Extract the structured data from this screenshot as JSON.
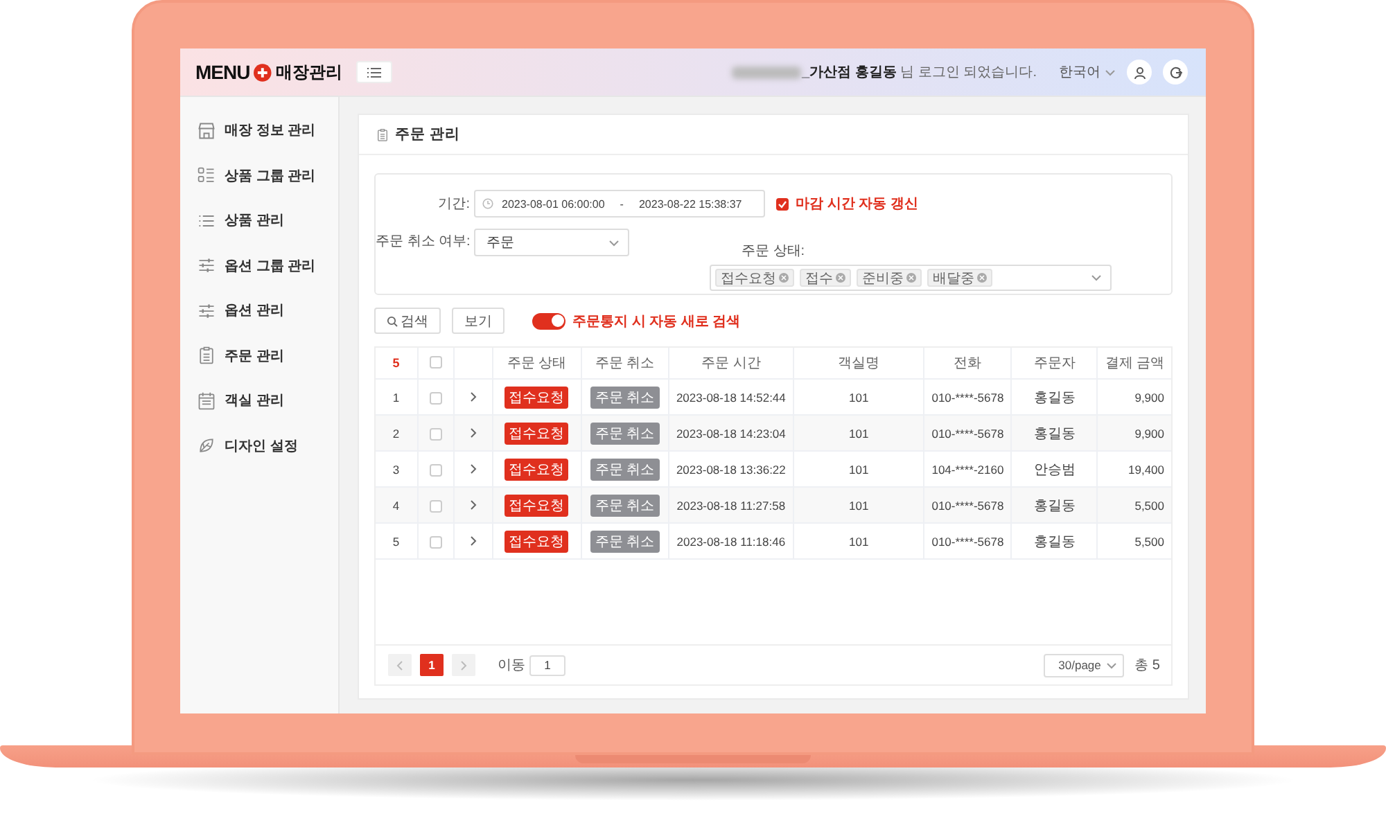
{
  "header": {
    "logo_text": "MENU",
    "logo_subtitle": "매장관리",
    "greeting": "**_가산점 홍길동** 님 로그인 되었습니다.",
    "language": "한국어"
  },
  "sidebar": {
    "items": [
      {
        "label": "매장 정보 관리"
      },
      {
        "label": "상품 그룹 관리"
      },
      {
        "label": "상품 관리"
      },
      {
        "label": "옵션 그룹 관리"
      },
      {
        "label": "옵션 관리"
      },
      {
        "label": "주문 관리"
      },
      {
        "label": "객실 관리"
      },
      {
        "label": "디자인 설정"
      }
    ]
  },
  "page": {
    "title": "주문 관리"
  },
  "filters": {
    "period_label": "기간:",
    "period_start": "2023-08-01 06:00:00",
    "period_separator": "-",
    "period_end": "2023-08-22 15:38:37",
    "auto_refresh": {
      "label": "마감 시간 자동 갱신",
      "checked": true
    },
    "cancel_label": "주문 취소 여부:",
    "cancel_value": "주문",
    "status_label": "주문 상태:",
    "status_tags": [
      "접수요청",
      "접수",
      "준비중",
      "배달중"
    ]
  },
  "actions": {
    "search": "검색",
    "view": "보기",
    "auto_search": {
      "label": "주문통지 시 자동 새로 검색",
      "on": true
    }
  },
  "table": {
    "count": "5",
    "header_checked": false,
    "columns": [
      "주문 상태",
      "주문 취소",
      "주문 시간",
      "객실명",
      "전화",
      "주문자",
      "결제 금액"
    ],
    "rows": [
      {
        "no": "1",
        "checked": false,
        "status": "접수요청",
        "cancel": "주문 취소",
        "time": "2023-08-18 14:52:44",
        "room": "101",
        "phone": "010-****-5678",
        "orderer": "홍길동",
        "amount": "9,900"
      },
      {
        "no": "2",
        "checked": false,
        "status": "접수요청",
        "cancel": "주문 취소",
        "time": "2023-08-18 14:23:04",
        "room": "101",
        "phone": "010-****-5678",
        "orderer": "홍길동",
        "amount": "9,900"
      },
      {
        "no": "3",
        "checked": false,
        "status": "접수요청",
        "cancel": "주문 취소",
        "time": "2023-08-18 13:36:22",
        "room": "101",
        "phone": "104-****-2160",
        "orderer": "안승범",
        "amount": "19,400"
      },
      {
        "no": "4",
        "checked": false,
        "status": "접수요청",
        "cancel": "주문 취소",
        "time": "2023-08-18 11:27:58",
        "room": "101",
        "phone": "010-****-5678",
        "orderer": "홍길동",
        "amount": "5,500"
      },
      {
        "no": "5",
        "checked": false,
        "status": "접수요청",
        "cancel": "주문 취소",
        "time": "2023-08-18 11:18:46",
        "room": "101",
        "phone": "010-****-5678",
        "orderer": "홍길동",
        "amount": "5,500"
      }
    ]
  },
  "pagination": {
    "pages": [
      {
        "label": "1",
        "selected": true
      }
    ],
    "goto_label": "이동",
    "goto_value": "1",
    "page_size": "30/page",
    "total": "총 5"
  }
}
